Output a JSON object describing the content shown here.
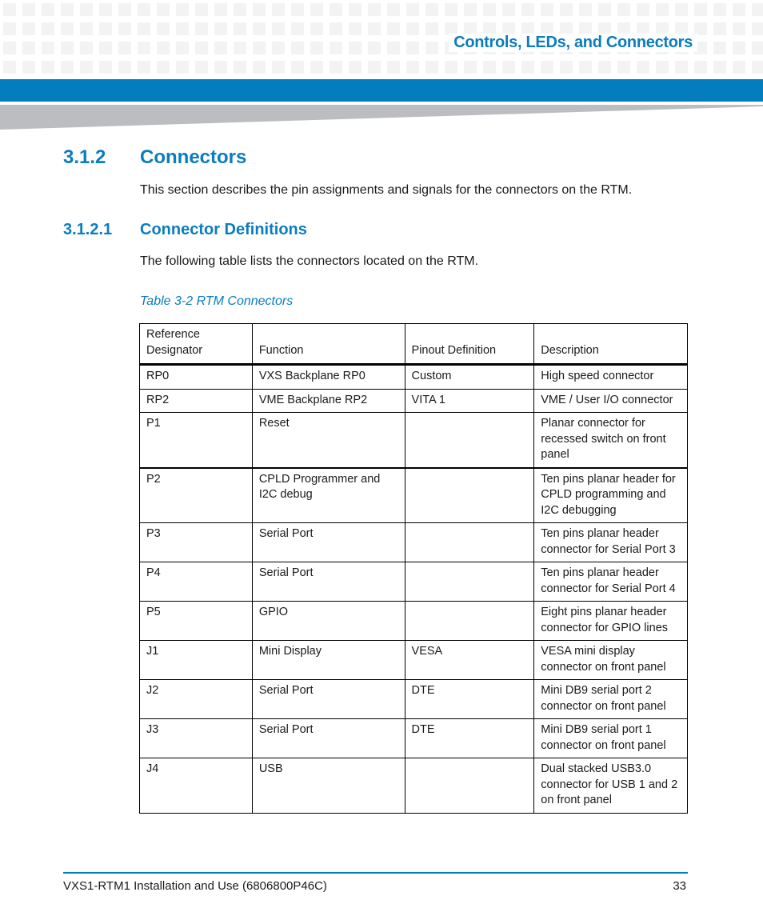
{
  "header": {
    "running_title": "Controls, LEDs, and Connectors",
    "accent_color": "#037dbd"
  },
  "section": {
    "number": "3.1.2",
    "title": "Connectors",
    "intro": "This section describes the pin assignments and signals for the connectors on the RTM."
  },
  "subsection": {
    "number": "3.1.2.1",
    "title": "Connector Definitions",
    "intro": "The following table lists the connectors located on the RTM."
  },
  "table": {
    "caption": "Table 3-2 RTM Connectors",
    "headers": [
      "Reference Designator",
      "Function",
      "Pinout Definition",
      "Description"
    ],
    "rows": [
      {
        "ref": "RP0",
        "function": "VXS Backplane RP0",
        "pinout": "Custom",
        "description": "High speed connector"
      },
      {
        "ref": "RP2",
        "function": "VME Backplane RP2",
        "pinout": "VITA 1",
        "description": "VME / User I/O connector"
      },
      {
        "ref": "P1",
        "function": "Reset",
        "pinout": "",
        "description": "Planar connector for recessed switch on front panel"
      },
      {
        "ref": "P2",
        "function": "CPLD Programmer and I2C debug",
        "pinout": "",
        "description": "Ten pins planar header for CPLD programming and I2C debugging"
      },
      {
        "ref": "P3",
        "function": "Serial Port",
        "pinout": "",
        "description": "Ten pins planar header connector for Serial Port 3"
      },
      {
        "ref": "P4",
        "function": "Serial Port",
        "pinout": "",
        "description": "Ten pins planar header connector for Serial Port 4"
      },
      {
        "ref": "P5",
        "function": "GPIO",
        "pinout": "",
        "description": "Eight pins planar header connector for GPIO lines"
      },
      {
        "ref": "J1",
        "function": "Mini Display",
        "pinout": "VESA",
        "description": "VESA mini display connector on front panel"
      },
      {
        "ref": "J2",
        "function": "Serial Port",
        "pinout": "DTE",
        "description": "Mini DB9 serial port 2 connector on front panel"
      },
      {
        "ref": "J3",
        "function": "Serial Port",
        "pinout": "DTE",
        "description": "Mini DB9 serial port 1 connector on front panel"
      },
      {
        "ref": "J4",
        "function": "USB",
        "pinout": "",
        "description": "Dual stacked USB3.0 connector for USB 1 and 2 on front panel"
      }
    ]
  },
  "footer": {
    "document_title": "VXS1-RTM1 Installation and Use (6806800P46C)",
    "page_number": "33"
  }
}
